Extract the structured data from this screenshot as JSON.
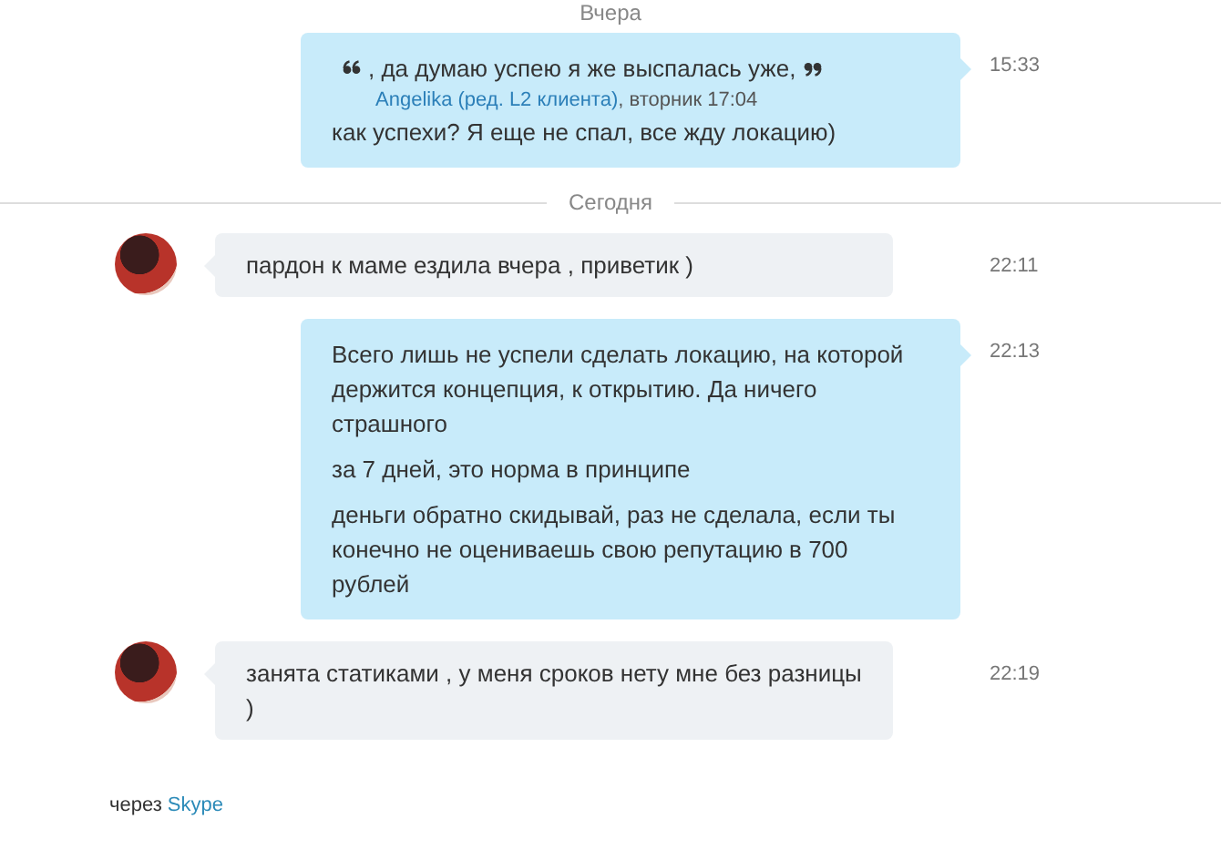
{
  "items": [
    {
      "kind": "date",
      "label": "Вчера"
    },
    {
      "kind": "outgoing",
      "time": "15:33",
      "quote": {
        "text": ", да думаю успею я же выспалась уже,",
        "author": "Angelika (ред. L2 клиента)",
        "when": ", вторник 17:04"
      },
      "paragraphs": [
        "как успехи? Я еще не спал, все жду локацию)"
      ]
    },
    {
      "kind": "date",
      "label": "Сегодня"
    },
    {
      "kind": "incoming",
      "time": "22:11",
      "paragraphs": [
        "пардон к маме ездила вчера , приветик )"
      ]
    },
    {
      "kind": "outgoing",
      "time": "22:13",
      "paragraphs": [
        "Всего лишь не успели сделать локацию, на которой держится концепция, к открытию. Да ничего страшного",
        "за 7 дней, это норма в принципе",
        "деньги обратно скидывай, раз не сделала, если ты конечно не оцениваешь свою репутацию в 700 рублей"
      ]
    },
    {
      "kind": "incoming",
      "time": "22:19",
      "paragraphs": [
        "занята статиками , у меня сроков нету мне без разницы )"
      ]
    }
  ],
  "footer": {
    "prefix": "через",
    "link": "Skype"
  }
}
